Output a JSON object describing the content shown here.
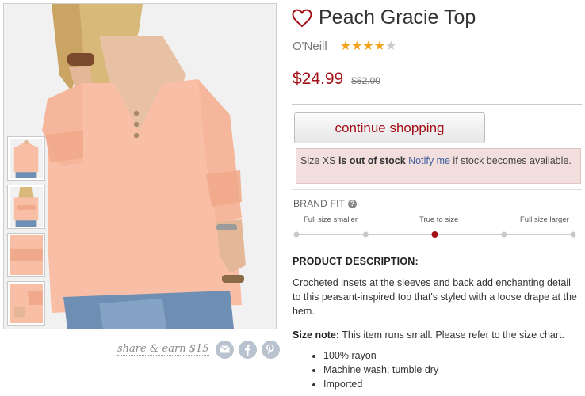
{
  "product": {
    "title": "Peach Gracie Top",
    "brand": "O'Neill",
    "rating": 4,
    "rating_max": 5,
    "price": "$24.99",
    "original_price": "$52.00"
  },
  "actions": {
    "continue_label": "continue shopping",
    "share_label": "share & earn $15"
  },
  "stock_alert": {
    "prefix": "Size XS ",
    "status": "is out of stock",
    "link": "Notify me",
    "suffix": " if stock becomes available."
  },
  "brand_fit": {
    "heading": "BRAND FIT",
    "labels": [
      "Full size smaller",
      "True to size",
      "Full size larger"
    ],
    "steps": 5,
    "selected_step": 2
  },
  "description": {
    "heading": "PRODUCT DESCRIPTION:",
    "text": "Crocheted insets at the sleeves and back add enchanting detail to this peasant-inspired top that's styled with a loose drape at the hem.",
    "size_note_label": "Size note:",
    "size_note_text": " This item runs small. Please refer to the size chart.",
    "bullets": [
      "100% rayon",
      "Machine wash; tumble dry",
      "Imported"
    ]
  },
  "colors": {
    "price": "#a30d16",
    "heart": "#a30d16",
    "star_on": "#f2a31b",
    "alert_bg": "#f3dede",
    "top_fabric": "#f8bfa6",
    "share_icons": "#b9c3cf"
  },
  "icons": [
    "heart-icon",
    "star-icon",
    "help-icon",
    "email-icon",
    "facebook-icon",
    "pinterest-icon"
  ]
}
